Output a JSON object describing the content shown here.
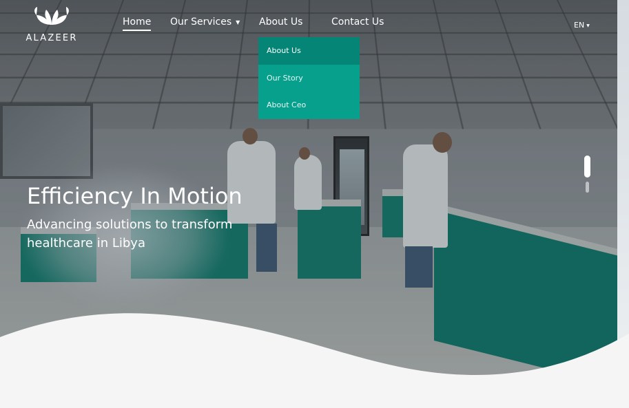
{
  "brand": {
    "name": "ALAZEER"
  },
  "nav": {
    "items": [
      {
        "label": "Home",
        "active": true
      },
      {
        "label": "Our Services",
        "has_dropdown": true
      },
      {
        "label": "About Us"
      },
      {
        "label": "Contact Us"
      }
    ],
    "language": "EN"
  },
  "dropdown": {
    "items": [
      {
        "label": "About Us",
        "active": true
      },
      {
        "label": "Our Story"
      },
      {
        "label": "About Ceo"
      }
    ]
  },
  "hero": {
    "headline": "Efficiency In Motion",
    "subheadline": "Advancing solutions to transform healthcare in Libya"
  },
  "slider": {
    "active_index": 0,
    "count": 2
  },
  "colors": {
    "accent": "#07a08c",
    "accent_dark": "#058575",
    "text": "#ffffff",
    "wave": "#f5f5f5"
  }
}
